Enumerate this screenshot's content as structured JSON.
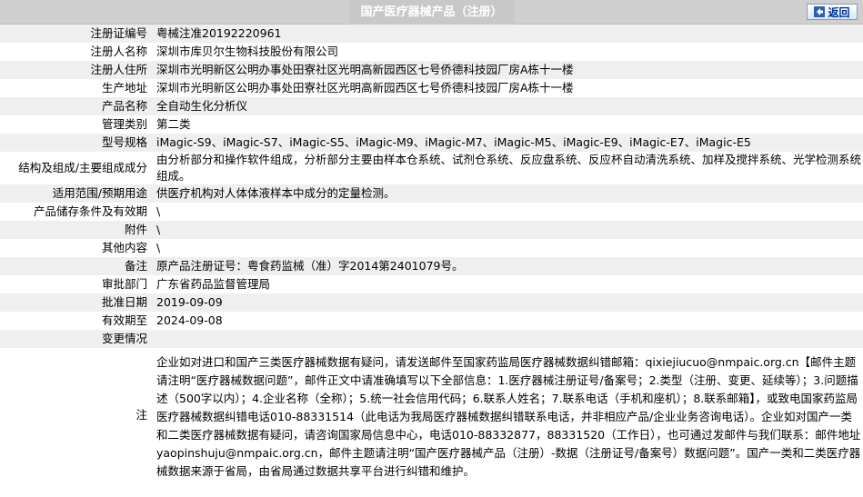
{
  "header": {
    "title": "国产医疗器械产品（注册）",
    "back_label": "返回"
  },
  "rows": [
    {
      "label": "注册证编号",
      "value": "粤械注准20192220961"
    },
    {
      "label": "注册人名称",
      "value": "深圳市库贝尔生物科技股份有限公司"
    },
    {
      "label": "注册人住所",
      "value": "深圳市光明新区公明办事处田寮社区光明高新园西区七号侨德科技园厂房A栋十一楼"
    },
    {
      "label": "生产地址",
      "value": "深圳市光明新区公明办事处田寮社区光明高新园西区七号侨德科技园厂房A栋十一楼"
    },
    {
      "label": "产品名称",
      "value": "全自动生化分析仪"
    },
    {
      "label": "管理类别",
      "value": "第二类"
    },
    {
      "label": "型号规格",
      "value": "iMagic-S9、iMagic-S7、iMagic-S5、iMagic-M9、iMagic-M7、iMagic-M5、iMagic-E9、iMagic-E7、iMagic-E5"
    },
    {
      "label": "结构及组成/主要组成成分",
      "value": "由分析部分和操作软件组成，分析部分主要由样本仓系统、试剂仓系统、反应盘系统、反应杯自动清洗系统、加样及搅拌系统、光学检测系统组成。"
    },
    {
      "label": "适用范围/预期用途",
      "value": "供医疗机构对人体体液样本中成分的定量检测。"
    },
    {
      "label": "产品储存条件及有效期",
      "value": "\\"
    },
    {
      "label": "附件",
      "value": "\\"
    },
    {
      "label": "其他内容",
      "value": "\\"
    },
    {
      "label": "备注",
      "value": "原产品注册证号：粤食药监械（准）字2014第2401079号。"
    },
    {
      "label": "审批部门",
      "value": "广东省药品监督管理局"
    },
    {
      "label": "批准日期",
      "value": "2019-09-09"
    },
    {
      "label": "有效期至",
      "value": "2024-09-08"
    },
    {
      "label": "变更情况",
      "value": ""
    }
  ],
  "note": {
    "label": "注",
    "value": "企业如对进口和国产三类医疗器械数据有疑问，请发送邮件至国家药监局医疗器械数据纠错邮箱：qixiejiucuo@nmpaic.org.cn【邮件主题请注明“医疗器械数据问题”，邮件正文中请准确填写以下全部信息：1.医疗器械注册证号/备案号；2.类型（注册、变更、延续等）；3.问题描述（500字以内）；4.企业名称（全称）；5.统一社会信用代码；6.联系人姓名；7.联系电话（手机和座机）；8.联系邮箱】，或致电国家药监局医疗器械数据纠错电话010-88331514（此电话为我局医疗器械数据纠错联系电话，并非相应产品/企业业务咨询电话）。企业如对国产一类和二类医疗器械数据有疑问，请咨询国家局信息中心，电话010-88332877，88331520（工作日），也可通过发邮件与我们联系：邮件地址yaopinshuju@nmpaic.org.cn，邮件主题请注明“国产医疗器械产品（注册）-数据（注册证号/备案号）数据问题”。国产一类和二类医疗器械数据来源于省局，由省局通过数据共享平台进行纠错和维护。"
  }
}
